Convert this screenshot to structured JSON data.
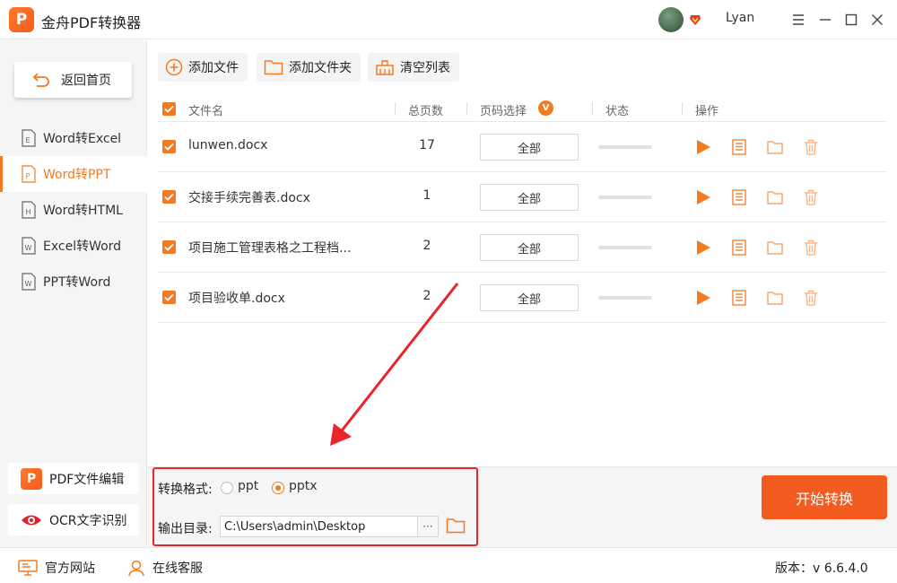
{
  "app": {
    "title": "金舟PDF转换器",
    "logo_letter": "P",
    "username": "Lyan"
  },
  "colors": {
    "accent": "#f47a20",
    "start": "#f45b1e",
    "annotation": "#e8262a"
  },
  "sidebar": {
    "home_label": "返回首页",
    "items": [
      {
        "label": "Word转Excel",
        "letter": "E",
        "active": false
      },
      {
        "label": "Word转PPT",
        "letter": "P",
        "active": true
      },
      {
        "label": "Word转HTML",
        "letter": "H",
        "active": false
      },
      {
        "label": "Excel转Word",
        "letter": "W",
        "active": false
      },
      {
        "label": "PPT转Word",
        "letter": "W",
        "active": false
      }
    ],
    "tools": [
      {
        "label": "PDF文件编辑",
        "icon": "pdf-edit-icon"
      },
      {
        "label": "OCR文字识别",
        "icon": "eye-icon"
      }
    ]
  },
  "toolbar": {
    "add_file": "添加文件",
    "add_folder": "添加文件夹",
    "clear_list": "清空列表"
  },
  "table": {
    "headers": {
      "name": "文件名",
      "pages": "总页数",
      "page_select": "页码选择",
      "status": "状态",
      "actions": "操作"
    },
    "page_select_badge": "V",
    "rows": [
      {
        "name": "lunwen.docx",
        "pages": "17",
        "range": "全部",
        "progress": 0
      },
      {
        "name": "交接手续完善表.docx",
        "pages": "1",
        "range": "全部",
        "progress": 0
      },
      {
        "name": "项目施工管理表格之工程档...",
        "pages": "2",
        "range": "全部",
        "progress": 0
      },
      {
        "name": "项目验收单.docx",
        "pages": "2",
        "range": "全部",
        "progress": 0
      }
    ]
  },
  "output": {
    "format_label": "转换格式:",
    "formats": [
      {
        "label": "ppt",
        "selected": false
      },
      {
        "label": "pptx",
        "selected": true
      }
    ],
    "dir_label": "输出目录:",
    "dir_value": "C:\\Users\\admin\\Desktop",
    "browse_label": "···",
    "start_label": "开始转换"
  },
  "footer": {
    "website": "官方网站",
    "support": "在线客服",
    "version": "版本：v 6.6.4.0"
  }
}
